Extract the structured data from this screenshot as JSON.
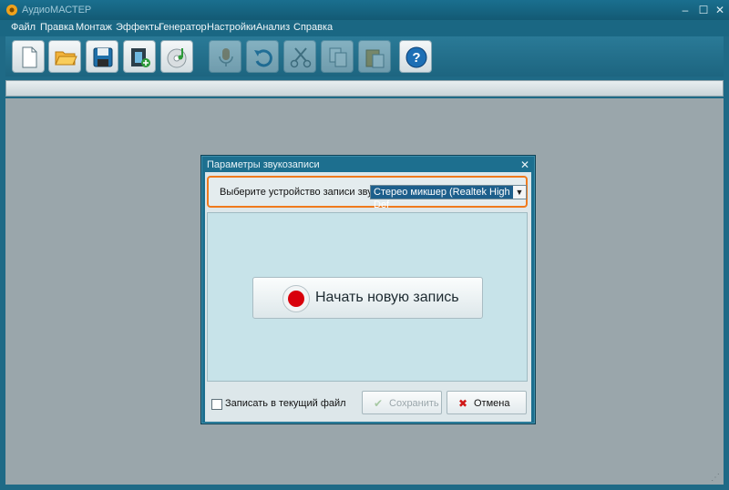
{
  "window": {
    "title": "АудиоМАСТЕР",
    "minimize_glyph": "–",
    "maximize_glyph": "☐",
    "close_glyph": "✕"
  },
  "menu": {
    "items": [
      "Файл",
      "Правка",
      "Монтаж",
      "Эффекты",
      "Генератор",
      "Настройки",
      "Анализ",
      "Справка"
    ]
  },
  "toolbar": {
    "buttons": [
      {
        "icon": "new-file-icon",
        "enabled": true
      },
      {
        "icon": "open-folder-icon",
        "enabled": true
      },
      {
        "icon": "save-icon",
        "enabled": true
      },
      {
        "icon": "video-add-icon",
        "enabled": true
      },
      {
        "icon": "cd-music-icon",
        "enabled": true
      },
      {
        "icon": "record-sound-icon",
        "enabled": false
      },
      {
        "icon": "undo-icon",
        "enabled": false
      },
      {
        "icon": "cut-icon",
        "enabled": false
      },
      {
        "icon": "copy-icon",
        "enabled": false
      },
      {
        "icon": "paste-icon",
        "enabled": false
      },
      {
        "icon": "help-icon",
        "enabled": true
      }
    ]
  },
  "dialog": {
    "title": "Параметры звукозаписи",
    "close_glyph": "✕",
    "device_label": "Выберите устройство записи звука:",
    "device_value": "Стерео микшер (Realtek High Def",
    "dropdown_glyph": "▼",
    "record_button_label": "Начать новую запись",
    "append_checkbox_label": "Записать в текущий файл",
    "append_checked": false,
    "save_label": "Сохранить",
    "cancel_label": "Отмена",
    "save_glyph": "✔",
    "cancel_glyph": "✖",
    "accent_color": "#f07a1c",
    "record_color": "#d8000b"
  }
}
